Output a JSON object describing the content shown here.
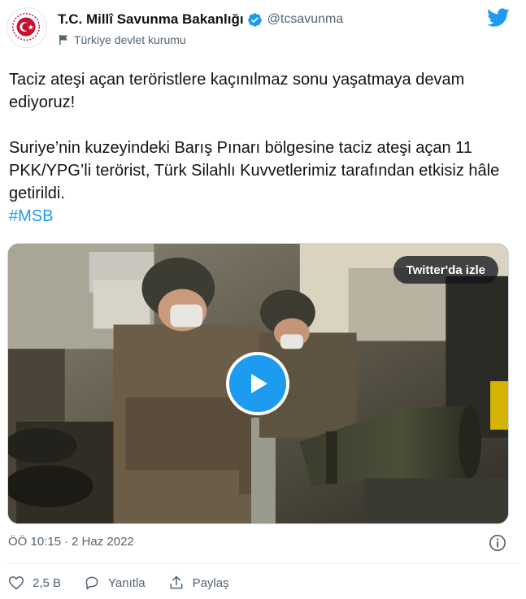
{
  "author": {
    "display_name": "T.C. Millî Savunma Bakanlığı",
    "handle": "@tcsavunma",
    "account_label": "Türkiye devlet kurumu"
  },
  "tweet": {
    "paragraph1": "Taciz ateşi açan teröristlere kaçınılmaz sonu yaşatmaya devam ediyoruz!",
    "paragraph2": "Suriye’nin kuzeyindeki Barış Pınarı bölgesine taciz ateşi açan 11 PKK/YPG’li terörist, Türk Silahlı Kuvvetlerimiz tarafından etkisiz hâle getirildi.",
    "hashtag": "#MSB"
  },
  "media": {
    "watch_label": "Twitter'da izle",
    "play_icon": "play-icon"
  },
  "meta": {
    "time": "ÖÖ 10:15",
    "separator": "·",
    "date": "2 Haz 2022"
  },
  "actions": {
    "likes": "2,5 B",
    "reply_label": "Yanıtla",
    "share_label": "Paylaş"
  },
  "colors": {
    "accent": "#1d9bf0",
    "text": "#0f1419",
    "secondary": "#536471",
    "verified": "#1d9bf0"
  }
}
